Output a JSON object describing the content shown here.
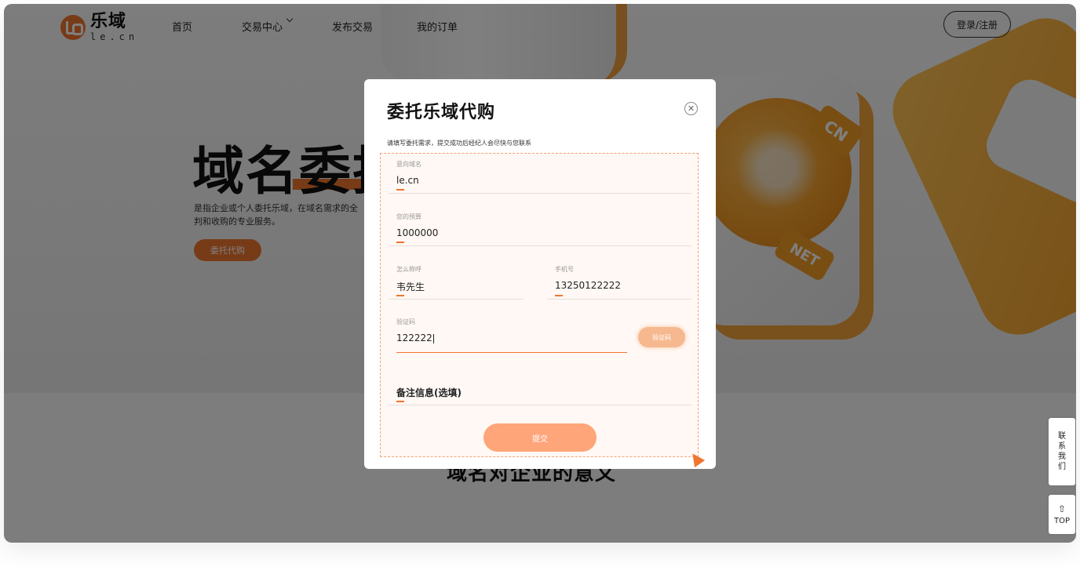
{
  "header": {
    "logo_cn": "乐域",
    "logo_en": "le.cn",
    "nav": [
      {
        "label": "首页"
      },
      {
        "label": "交易中心"
      },
      {
        "label": "发布交易"
      },
      {
        "label": "我的订单"
      }
    ],
    "login_label": "登录/注册"
  },
  "hero": {
    "title": "域名委托",
    "desc": "是指企业或个人委托乐域，在域名需求的全\n判和收购的专业服务。",
    "button_label": "委托代购",
    "tags": [
      "CN",
      "NET"
    ]
  },
  "lower": {
    "title": "域名对企业的意义"
  },
  "side": {
    "contact_label": "联系我们",
    "top_label": "TOP"
  },
  "modal": {
    "title": "委托乐域代购",
    "subtitle": "请填写委托需求，提交成功后经纪人会尽快与您联系",
    "fields": {
      "domain": {
        "label": "意向域名",
        "value": "le.cn"
      },
      "budget": {
        "label": "您的预算",
        "value": "1000000"
      },
      "name": {
        "label": "怎么称呼",
        "value": "韦先生"
      },
      "phone": {
        "label": "手机号",
        "value": "13250122222"
      },
      "code": {
        "label": "验证码",
        "value": "122222"
      }
    },
    "code_button": "验证码",
    "remark_label": "备注信息(选填)",
    "submit_label": "提交"
  },
  "colors": {
    "accent": "#f0762f",
    "submit": "#ffa57a"
  }
}
